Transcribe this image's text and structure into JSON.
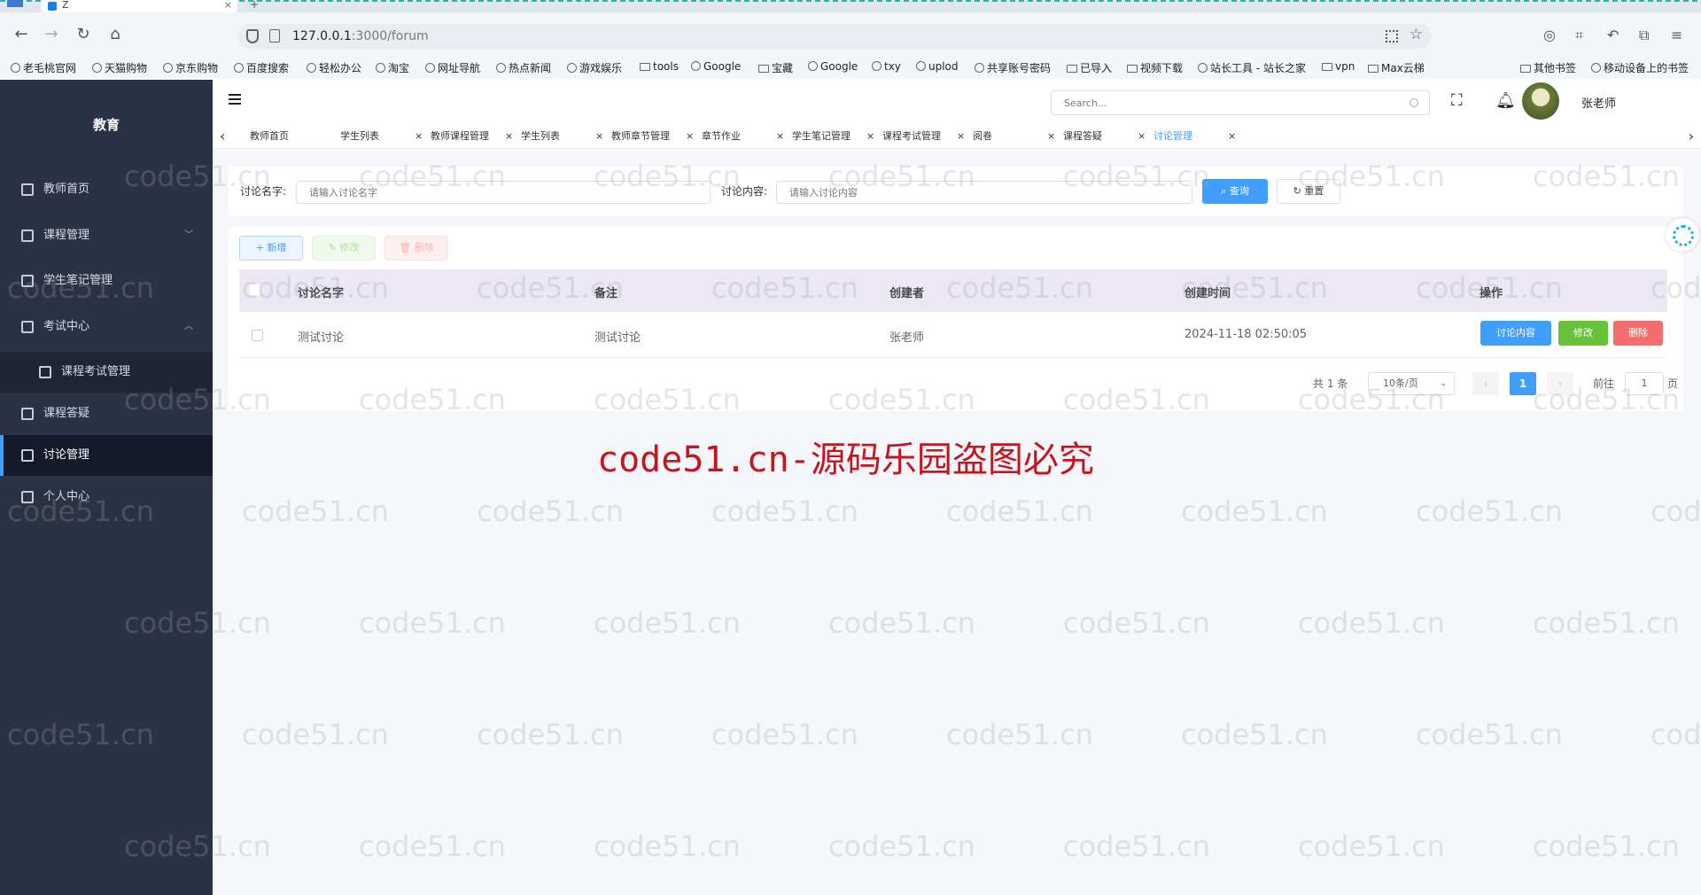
{
  "browser": {
    "tab_title": "Z",
    "tab_close": "×",
    "new_tab": "+",
    "url_host": "127.0.0.1",
    "url_path": ":3000/forum",
    "bookmarks": [
      {
        "label": "老毛桃官网",
        "icon": "globe-icon"
      },
      {
        "label": "天猫购物",
        "icon": "globe-icon"
      },
      {
        "label": "京东购物",
        "icon": "globe-icon"
      },
      {
        "label": "百度搜索",
        "icon": "globe-icon"
      },
      {
        "label": "轻松办公",
        "icon": "globe-icon"
      },
      {
        "label": "淘宝",
        "icon": "globe-icon"
      },
      {
        "label": "网址导航",
        "icon": "globe-icon"
      },
      {
        "label": "热点新闻",
        "icon": "globe-icon"
      },
      {
        "label": "游戏娱乐",
        "icon": "globe-icon"
      },
      {
        "label": "tools",
        "icon": "folder-icon"
      },
      {
        "label": "Google",
        "icon": "globe-icon"
      },
      {
        "label": "宝藏",
        "icon": "folder-icon"
      },
      {
        "label": "Google",
        "icon": "google-icon"
      },
      {
        "label": "txy",
        "icon": "cloud-icon"
      },
      {
        "label": "uplod",
        "icon": "cloud-icon"
      },
      {
        "label": "共享账号密码",
        "icon": "sheet-icon"
      },
      {
        "label": "已导入",
        "icon": "folder-icon"
      },
      {
        "label": "视频下载",
        "icon": "folder-icon"
      },
      {
        "label": "站长工具 - 站长之家",
        "icon": "site-icon"
      },
      {
        "label": "vpn",
        "icon": "folder-icon"
      },
      {
        "label": "Max云梯",
        "icon": "folder-icon"
      },
      {
        "label": "其他书签",
        "icon": "folder-icon"
      },
      {
        "label": "移动设备上的书签",
        "icon": "phone-icon"
      }
    ]
  },
  "sidebar": {
    "brand": "教育",
    "items": [
      {
        "label": "教师首页",
        "icon": "bar-chart-icon"
      },
      {
        "label": "课程管理",
        "icon": "clipboard-icon",
        "arrow": "﹀"
      },
      {
        "label": "学生笔记管理",
        "icon": "document-icon"
      },
      {
        "label": "考试中心",
        "icon": "send-icon",
        "arrow": "︿"
      },
      {
        "label": "课程考试管理",
        "icon": "clipboard-icon"
      },
      {
        "label": "课程答疑",
        "icon": "trend-icon"
      },
      {
        "label": "讨论管理",
        "icon": "book-icon"
      },
      {
        "label": "个人中心",
        "icon": "hand-icon"
      }
    ]
  },
  "header": {
    "search_placeholder": "Search...",
    "username": "张老师"
  },
  "tags": [
    {
      "label": "教师首页",
      "closable": false
    },
    {
      "label": "学生列表",
      "closable": true
    },
    {
      "label": "教师课程管理",
      "closable": true
    },
    {
      "label": "学生列表",
      "closable": true
    },
    {
      "label": "教师章节管理",
      "closable": true
    },
    {
      "label": "章节作业",
      "closable": true
    },
    {
      "label": "学生笔记管理",
      "closable": true
    },
    {
      "label": "课程考试管理",
      "closable": true
    },
    {
      "label": "阅卷",
      "closable": true
    },
    {
      "label": "课程答疑",
      "closable": true
    },
    {
      "label": "讨论管理",
      "closable": true,
      "active": true
    }
  ],
  "tag_close": "×",
  "search": {
    "name_label": "讨论名字:",
    "name_placeholder": "请输入讨论名字",
    "content_label": "讨论内容:",
    "content_placeholder": "请输入讨论内容",
    "query_btn": "查询",
    "reset_btn": "重置"
  },
  "actions": {
    "add": "+ 新增",
    "edit": "修改",
    "delete": "删除"
  },
  "table": {
    "columns": [
      "讨论名字",
      "备注",
      "创建者",
      "创建时间",
      "操作"
    ],
    "rows": [
      {
        "name": "测试讨论",
        "remark": "测试讨论",
        "creator": "张老师",
        "created": "2024-11-18 02:50:05"
      }
    ],
    "row_actions": {
      "content": "讨论内容",
      "edit": "修改",
      "delete": "删除"
    }
  },
  "pager": {
    "total_prefix": "共",
    "total": "1",
    "total_suffix": "条",
    "page_size": "10条/页",
    "prev": "‹",
    "current": "1",
    "next": "›",
    "goto_prefix": "前往",
    "goto_value": "1",
    "goto_suffix": "页"
  },
  "watermark": {
    "headline": "code51.cn-源码乐园盗图必究",
    "tile": "code51.cn"
  },
  "colors": {
    "sidebar": "#2b3245",
    "primary": "#409eff",
    "success": "#67c23a",
    "danger": "#f56c6c",
    "watermark_red": "#c8141e"
  }
}
